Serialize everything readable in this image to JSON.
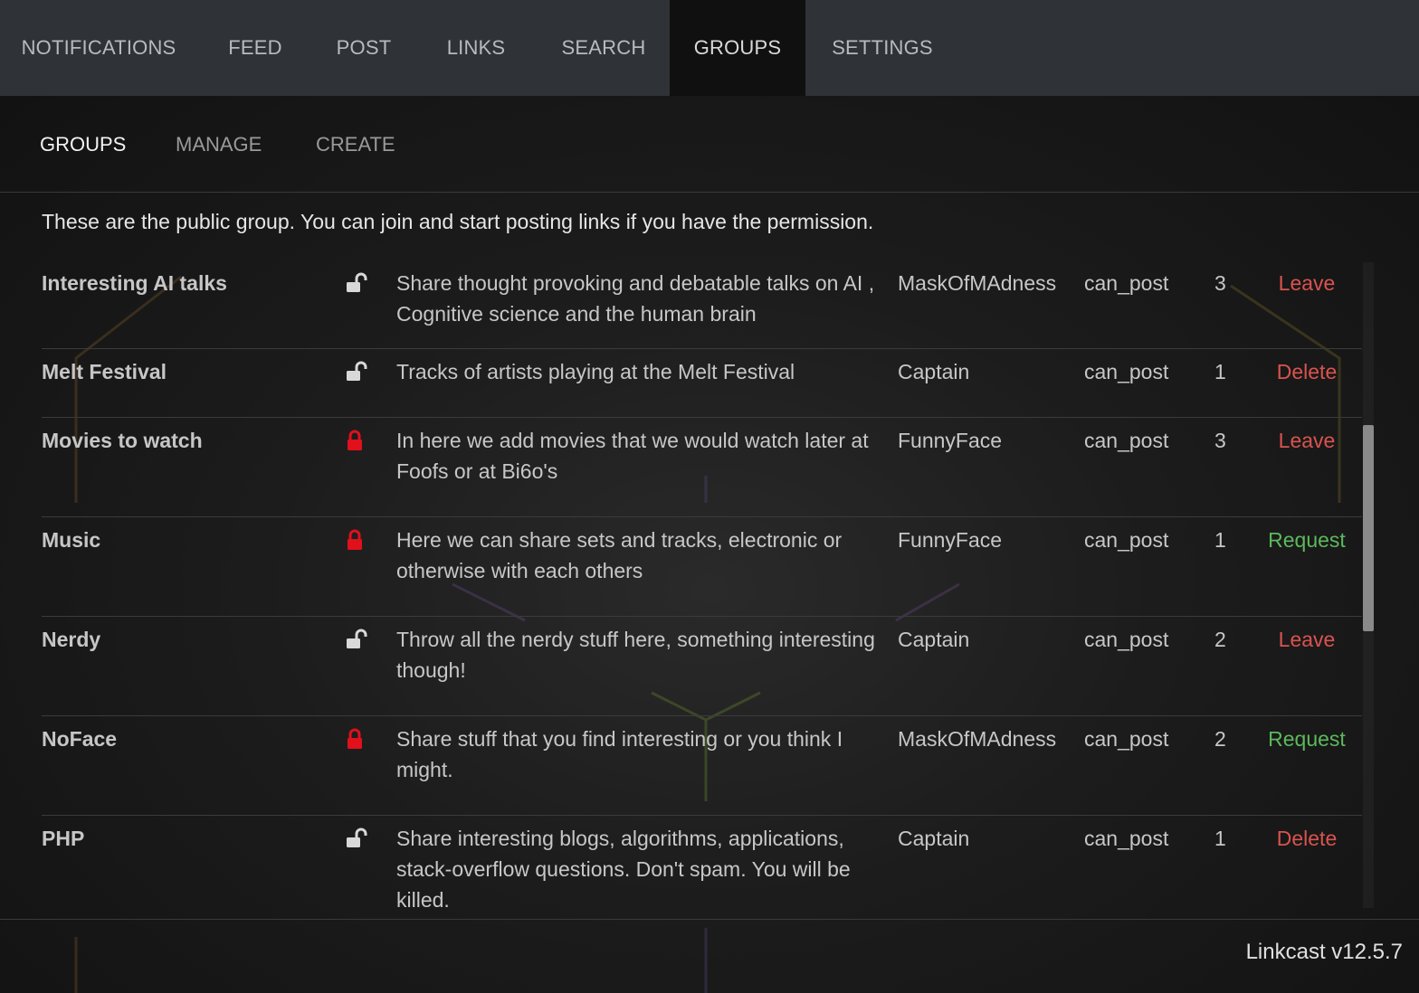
{
  "nav": {
    "tabs": [
      {
        "label": "NOTIFICATIONS"
      },
      {
        "label": "FEED"
      },
      {
        "label": "POST"
      },
      {
        "label": "LINKS"
      },
      {
        "label": "SEARCH"
      },
      {
        "label": "GROUPS"
      },
      {
        "label": "SETTINGS"
      }
    ],
    "active": "GROUPS"
  },
  "subnav": {
    "tabs": [
      {
        "label": "GROUPS"
      },
      {
        "label": "MANAGE"
      },
      {
        "label": "CREATE"
      }
    ],
    "active": "GROUPS"
  },
  "intro": "These are the public group. You can join and start posting links if you have the permission.",
  "groups": [
    {
      "name": "Interesting AI talks",
      "lock": "unlocked-icon",
      "description": "Share thought provoking and debatable talks on AI , Cognitive science and the human brain",
      "owner": "MaskOfMAdness",
      "permission": "can_post",
      "members": "3",
      "action": "Leave",
      "action_color": "#d9534f"
    },
    {
      "name": "Melt Festival",
      "lock": "unlocked-icon",
      "description": "Tracks of artists playing at the Melt Festival",
      "owner": "Captain",
      "permission": "can_post",
      "members": "1",
      "action": "Delete",
      "action_color": "#d9534f"
    },
    {
      "name": "Movies to watch",
      "lock": "locked-icon",
      "description": "In here we add movies that we would watch later at Foofs or at Bi6o's",
      "owner": "FunnyFace",
      "permission": "can_post",
      "members": "3",
      "action": "Leave",
      "action_color": "#d9534f"
    },
    {
      "name": "Music",
      "lock": "locked-icon",
      "description": "Here we can share sets and tracks, electronic or otherwise with each others",
      "owner": "FunnyFace",
      "permission": "can_post",
      "members": "1",
      "action": "Request",
      "action_color": "#5cb85c"
    },
    {
      "name": "Nerdy",
      "lock": "unlocked-icon",
      "description": "Throw all the nerdy stuff here, something interesting though!",
      "owner": "Captain",
      "permission": "can_post",
      "members": "2",
      "action": "Leave",
      "action_color": "#d9534f"
    },
    {
      "name": "NoFace",
      "lock": "locked-icon",
      "description": "Share stuff that you find interesting or you think I might.",
      "owner": "MaskOfMAdness",
      "permission": "can_post",
      "members": "2",
      "action": "Request",
      "action_color": "#5cb85c"
    },
    {
      "name": "PHP",
      "lock": "unlocked-icon",
      "description": "Share interesting blogs, algorithms, applications, stack-overflow questions. Don't spam. You will be killed.",
      "owner": "Captain",
      "permission": "can_post",
      "members": "1",
      "action": "Delete",
      "action_color": "#d9534f"
    }
  ],
  "footer": {
    "version": "Linkcast v12.5.7"
  },
  "colors": {
    "locked": "#e0101c",
    "unlocked": "#d8d8d8",
    "accent_red": "#d9534f",
    "accent_green": "#5cb85c"
  }
}
